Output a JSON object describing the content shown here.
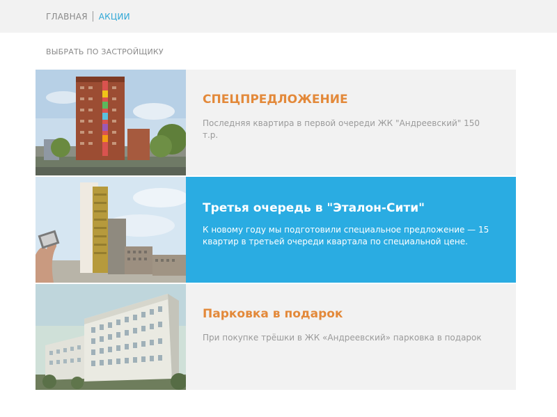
{
  "breadcrumb": {
    "home": "ГЛАВНАЯ",
    "current": "АКЦИИ"
  },
  "filter": {
    "label": "ВЫБРАТЬ ПО ЗАСТРОЙЩИКУ"
  },
  "promos": [
    {
      "title": "СПЕЦПРЕДЛОЖЕНИЕ",
      "description": "Последняя квартира в первой очереди ЖК \"Андреевский\" 150 т.р."
    },
    {
      "title": "Третья очередь в \"Эталон-Сити\"",
      "description": "К новому году мы подготовили специальное предложение — 15 квартир в третьей очереди квартала по специальной цене."
    },
    {
      "title": "Парковка в подарок",
      "description": "При покупке трёшки в ЖК «Андреевский» парковка в подарок"
    }
  ],
  "colors": {
    "accent_orange": "#e3893a",
    "accent_blue": "#2aace2",
    "card_bg": "#f2f2f2",
    "muted_text": "#9a9a9a"
  }
}
